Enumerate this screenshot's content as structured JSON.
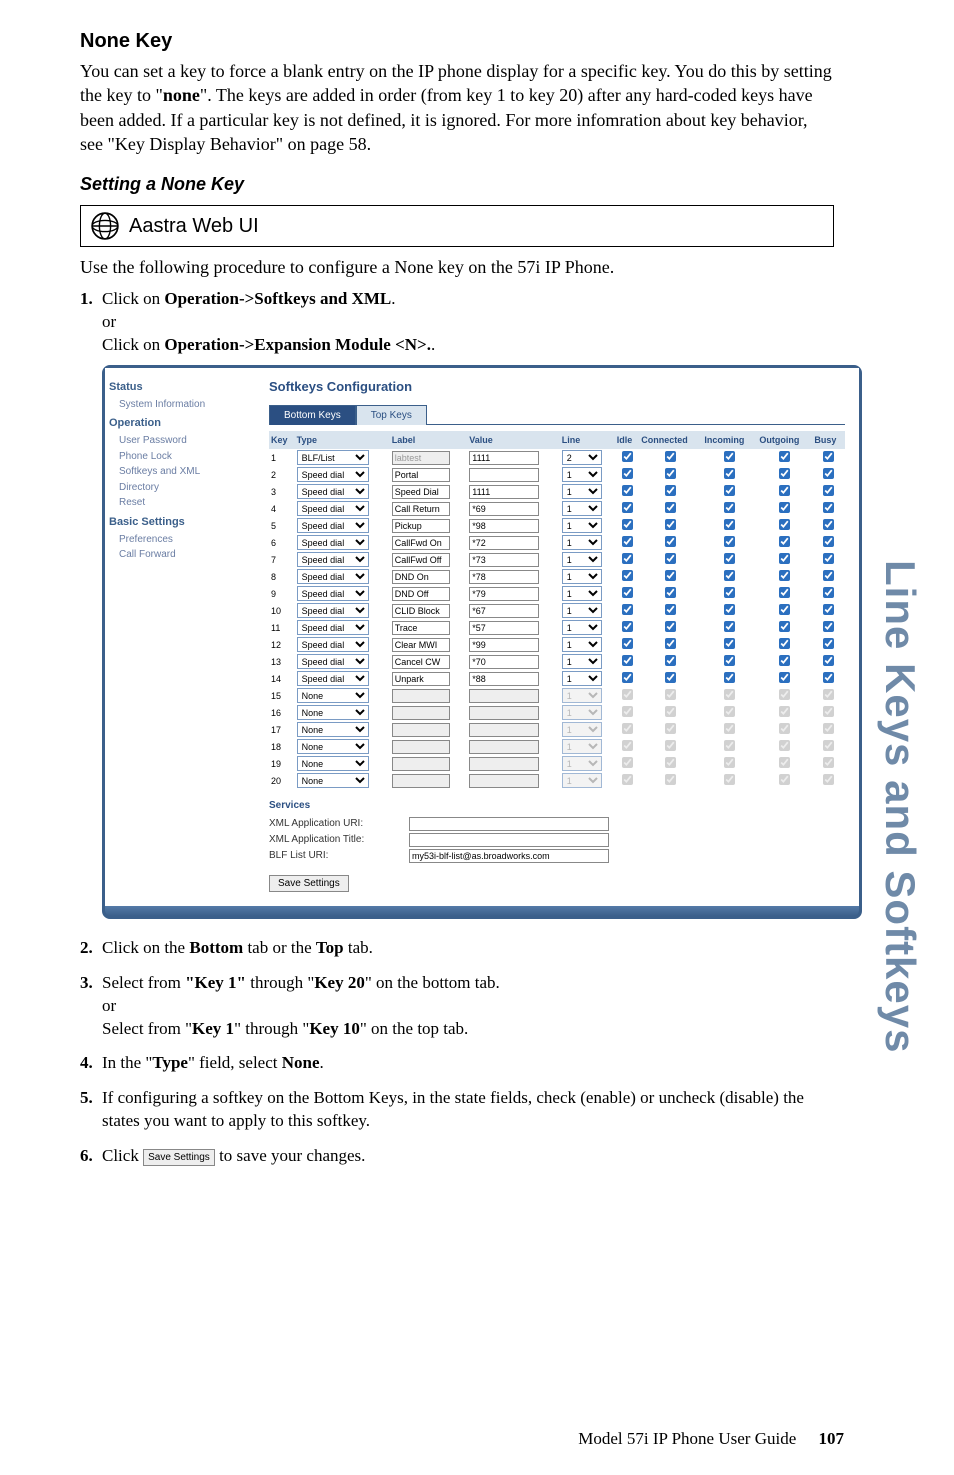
{
  "side_title": "Line Keys and Softkeys",
  "footer_text": "Model 57i IP Phone User Guide",
  "footer_page": "107",
  "section": {
    "none_key_heading": "None Key",
    "intro": "You can set a key to force a blank entry on the IP phone display for a specific key. You do this by setting the key to \"",
    "intro_bold": "none",
    "intro2": "\". The keys are added in order (from key 1 to key 20) after any hard-coded keys have been added. If a particular key is not defined, it is ignored. For more infomration about key behavior, see \"Key Display Behavior\" on page 58.",
    "setting_heading": "Setting a None Key",
    "webui_title": "Aastra Web UI",
    "procedure_intro": "Use the following procedure to configure a None key on the 57i IP Phone."
  },
  "steps": {
    "s1a": "Click on ",
    "s1b": "Operation->Softkeys and XML",
    "s1c": ".",
    "s1_or": "or",
    "s1d": "Click on ",
    "s1e": "Operation->Expansion Module <N>.",
    "s1f": ".",
    "s2a": "Click on the ",
    "s2b": "Bottom",
    "s2c": " tab or the ",
    "s2d": "Top",
    "s2e": " tab.",
    "s3a": "Select from ",
    "s3b": "\"Key 1\"",
    "s3c": " through \"",
    "s3d": "Key 20",
    "s3e": "\" on the bottom tab.",
    "s3_or": "or",
    "s3f": "Select from \"",
    "s3g": "Key 1",
    "s3h": "\" through \"",
    "s3i": "Key 10",
    "s3j": "\" on the top tab.",
    "s4a": "In the \"",
    "s4b": "Type",
    "s4c": "\" field, select ",
    "s4d": "None",
    "s4e": ".",
    "s5": "If configuring a softkey on the Bottom Keys, in the state fields, check (enable) or uncheck (disable) the states you want to apply to this softkey.",
    "s6a": "Click ",
    "s6btn": "Save Settings",
    "s6b": " to save your changes."
  },
  "shot": {
    "panel_title": "Softkeys Configuration",
    "tabs": {
      "bottom": "Bottom Keys",
      "top": "Top Keys"
    },
    "nav": {
      "status": "Status",
      "sysinfo": "System Information",
      "operation": "Operation",
      "userpw": "User Password",
      "phonelock": "Phone Lock",
      "softkeys": "Softkeys and XML",
      "directory": "Directory",
      "reset": "Reset",
      "basic": "Basic Settings",
      "prefs": "Preferences",
      "callfwd": "Call Forward"
    },
    "headers": {
      "key": "Key",
      "type": "Type",
      "label": "Label",
      "value": "Value",
      "line": "Line",
      "idle": "Idle",
      "connected": "Connected",
      "incoming": "Incoming",
      "outgoing": "Outgoing",
      "busy": "Busy"
    },
    "rows": [
      {
        "k": "1",
        "type": "BLF/List",
        "label": "labtest",
        "value": "1111",
        "line": "2",
        "enabled": true,
        "labelDisabled": true
      },
      {
        "k": "2",
        "type": "Speed dial",
        "label": "Portal",
        "value": "",
        "line": "1",
        "enabled": true
      },
      {
        "k": "3",
        "type": "Speed dial",
        "label": "Speed Dial",
        "value": "1111",
        "line": "1",
        "enabled": true
      },
      {
        "k": "4",
        "type": "Speed dial",
        "label": "Call Return",
        "value": "*69",
        "line": "1",
        "enabled": true
      },
      {
        "k": "5",
        "type": "Speed dial",
        "label": "Pickup",
        "value": "*98",
        "line": "1",
        "enabled": true
      },
      {
        "k": "6",
        "type": "Speed dial",
        "label": "CallFwd On",
        "value": "*72",
        "line": "1",
        "enabled": true
      },
      {
        "k": "7",
        "type": "Speed dial",
        "label": "CallFwd Off",
        "value": "*73",
        "line": "1",
        "enabled": true
      },
      {
        "k": "8",
        "type": "Speed dial",
        "label": "DND On",
        "value": "*78",
        "line": "1",
        "enabled": true
      },
      {
        "k": "9",
        "type": "Speed dial",
        "label": "DND Off",
        "value": "*79",
        "line": "1",
        "enabled": true
      },
      {
        "k": "10",
        "type": "Speed dial",
        "label": "CLID Block",
        "value": "*67",
        "line": "1",
        "enabled": true
      },
      {
        "k": "11",
        "type": "Speed dial",
        "label": "Trace",
        "value": "*57",
        "line": "1",
        "enabled": true
      },
      {
        "k": "12",
        "type": "Speed dial",
        "label": "Clear MWI",
        "value": "*99",
        "line": "1",
        "enabled": true
      },
      {
        "k": "13",
        "type": "Speed dial",
        "label": "Cancel CW",
        "value": "*70",
        "line": "1",
        "enabled": true
      },
      {
        "k": "14",
        "type": "Speed dial",
        "label": "Unpark",
        "value": "*88",
        "line": "1",
        "enabled": true
      },
      {
        "k": "15",
        "type": "None",
        "label": "",
        "value": "",
        "line": "1",
        "enabled": false
      },
      {
        "k": "16",
        "type": "None",
        "label": "",
        "value": "",
        "line": "1",
        "enabled": false
      },
      {
        "k": "17",
        "type": "None",
        "label": "",
        "value": "",
        "line": "1",
        "enabled": false
      },
      {
        "k": "18",
        "type": "None",
        "label": "",
        "value": "",
        "line": "1",
        "enabled": false
      },
      {
        "k": "19",
        "type": "None",
        "label": "",
        "value": "",
        "line": "1",
        "enabled": false
      },
      {
        "k": "20",
        "type": "None",
        "label": "",
        "value": "",
        "line": "1",
        "enabled": false
      }
    ],
    "services": {
      "header": "Services",
      "xml_uri_label": "XML Application URI:",
      "xml_title_label": "XML Application Title:",
      "blf_uri_label": "BLF List URI:",
      "blf_uri_value": "my53i-blf-list@as.broadworks.com"
    },
    "save": "Save Settings"
  }
}
